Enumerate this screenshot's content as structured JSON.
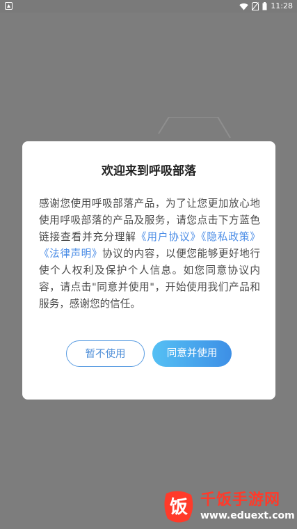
{
  "status_bar": {
    "time": "11:28",
    "icons": [
      "app-notification-icon",
      "wifi-icon",
      "no-sim-icon",
      "battery-icon"
    ]
  },
  "dialog": {
    "title": "欢迎来到呼吸部落",
    "body_intro": "感谢您使用呼吸部落产品，为了让您更加放心地使用呼吸部落的产品及服务，请您点击下方蓝色链接查看并充分理解",
    "link_user_agreement": "《用户协议》",
    "link_privacy_policy": "《隐私政策》",
    "link_legal_statement": "《法律声明》",
    "body_rest": "协议的内容，以便您能够更好地行使个人权利及保护个人信息。如您同意协议内容，请点击\"同意并使用\"，开始使用我们产品和服务，感谢您的信任。",
    "decline_label": "暂不使用",
    "agree_label": "同意并使用"
  },
  "watermark": {
    "logo_glyph": "饭",
    "name": "千饭手游网",
    "url": "www.eduext.com"
  },
  "colors": {
    "overlay": "#7d7d7d",
    "link": "#4a8ce6",
    "button_gradient_start": "#55c0f4",
    "button_gradient_end": "#3d8fe6",
    "watermark_red": "#ff3a2a"
  }
}
